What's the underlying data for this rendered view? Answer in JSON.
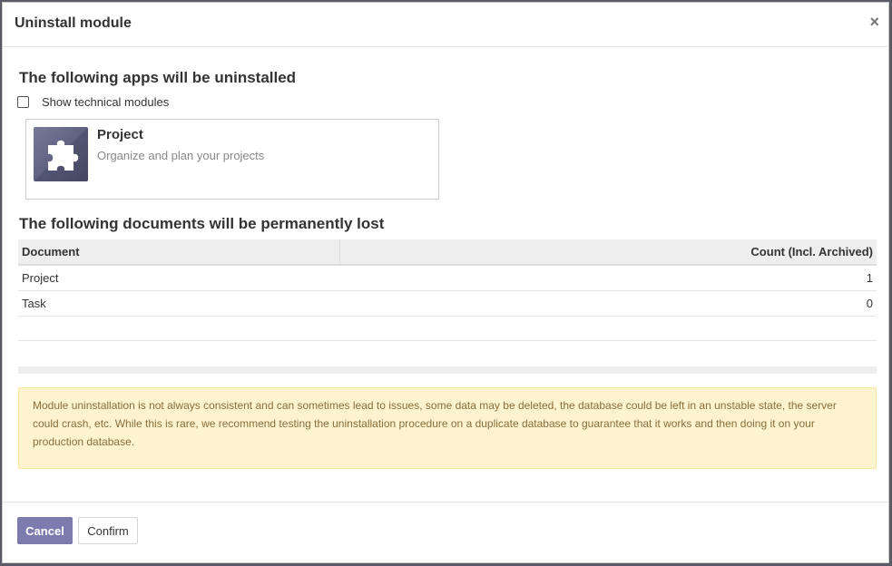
{
  "modal": {
    "title": "Uninstall module",
    "close_glyph": "×"
  },
  "apps_section": {
    "title": "The following apps will be uninstalled",
    "show_technical_label": "Show technical modules",
    "show_technical_checked": false,
    "apps": [
      {
        "name": "Project",
        "description": "Organize and plan your projects",
        "icon": "puzzle-piece-icon"
      }
    ]
  },
  "docs_section": {
    "title": "The following documents will be permanently lost",
    "columns": [
      "Document",
      "Count (Incl. Archived)"
    ],
    "rows": [
      {
        "document": "Project",
        "count": "1"
      },
      {
        "document": "Task",
        "count": "0"
      }
    ]
  },
  "warning": {
    "text": "Module uninstallation is not always consistent and can sometimes lead to issues, some data may be deleted, the database could be left in an unstable state, the server could crash, etc. While this is rare, we recommend testing the uninstallation procedure on a duplicate database to guarantee that it works and then doing it on your production database."
  },
  "footer": {
    "cancel_label": "Cancel",
    "confirm_label": "Confirm"
  },
  "colors": {
    "primary": "#7c7bad",
    "warning_bg": "#fdf3cf",
    "warning_text": "#8a6d3b"
  }
}
